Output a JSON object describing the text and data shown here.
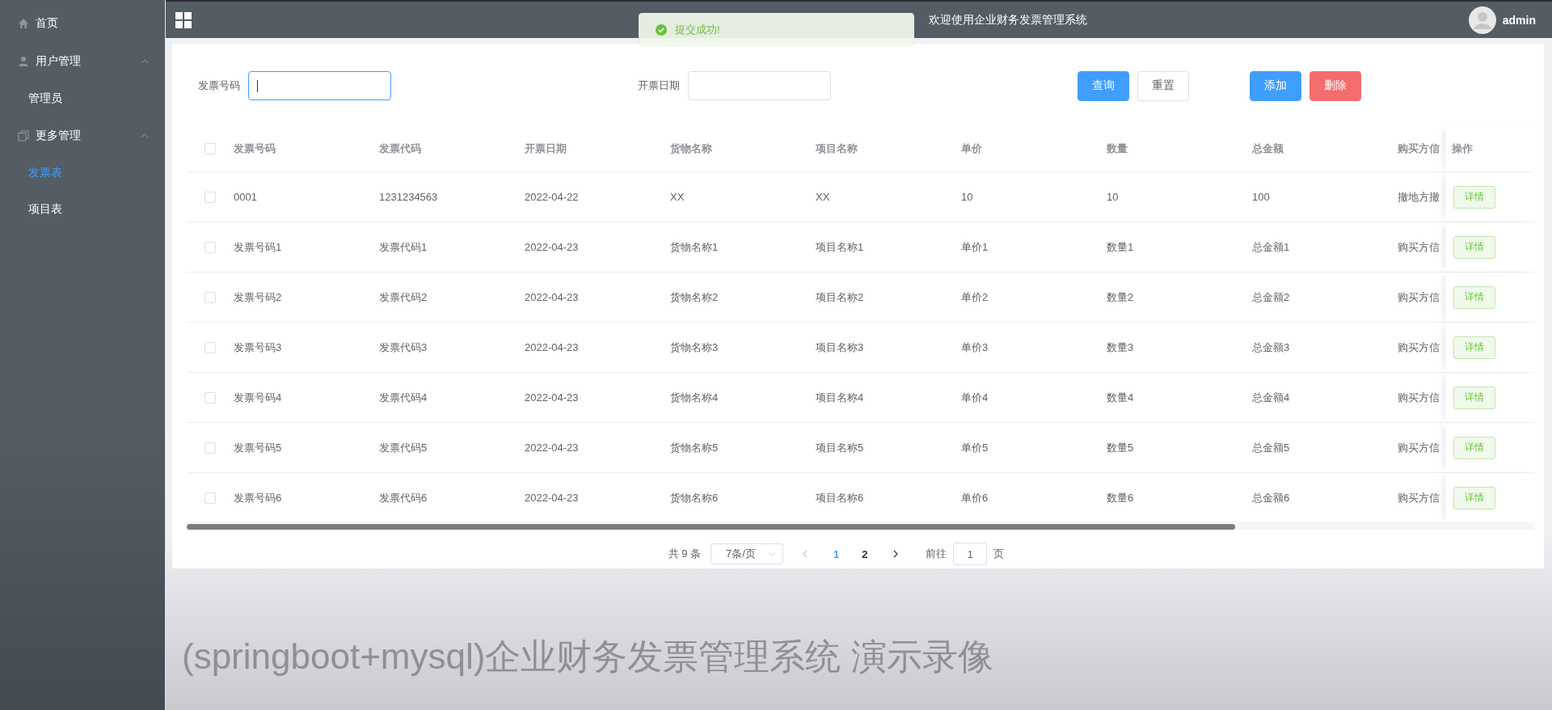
{
  "header": {
    "title": "欢迎使用企业财务发票管理系统",
    "user": "admin"
  },
  "toast": {
    "message": "提交成功!"
  },
  "sidebar": {
    "items": [
      {
        "label": "首页",
        "kind": "link",
        "selected": false
      },
      {
        "label": "用户管理",
        "kind": "group",
        "expanded": true,
        "children": [
          {
            "label": "管理员",
            "selected": false
          }
        ]
      },
      {
        "label": "更多管理",
        "kind": "group",
        "expanded": true,
        "children": [
          {
            "label": "发票表",
            "selected": true
          },
          {
            "label": "项目表",
            "selected": false
          }
        ]
      }
    ]
  },
  "filters": [
    {
      "label": "发票号码",
      "focused": true
    },
    {
      "label": "开票日期",
      "focused": false
    }
  ],
  "buttons": [
    {
      "label": "查询",
      "kind": "primary"
    },
    {
      "label": "重置",
      "kind": "default"
    },
    {
      "label": "添加",
      "kind": "primary"
    },
    {
      "label": "删除",
      "kind": "danger"
    }
  ],
  "table": {
    "all_checked": false,
    "columns": [
      "发票号码",
      "发票代码",
      "开票日期",
      "货物名称",
      "项目名称",
      "单价",
      "数量",
      "总金额",
      "购买方信"
    ],
    "action_column": "操作",
    "rows": [
      {
        "checked": false,
        "cells": [
          "0001",
          "1231234563",
          "2022-04-22",
          "XX",
          "XX",
          "10",
          "10",
          "100",
          "撤地方撤"
        ],
        "action": "详情"
      },
      {
        "checked": false,
        "cells": [
          "发票号码1",
          "发票代码1",
          "2022-04-23",
          "货物名称1",
          "项目名称1",
          "单价1",
          "数量1",
          "总金额1",
          "购买方信"
        ],
        "action": "详情"
      },
      {
        "checked": false,
        "cells": [
          "发票号码2",
          "发票代码2",
          "2022-04-23",
          "货物名称2",
          "项目名称2",
          "单价2",
          "数量2",
          "总金额2",
          "购买方信"
        ],
        "action": "详情"
      },
      {
        "checked": false,
        "cells": [
          "发票号码3",
          "发票代码3",
          "2022-04-23",
          "货物名称3",
          "项目名称3",
          "单价3",
          "数量3",
          "总金额3",
          "购买方信"
        ],
        "action": "详情"
      },
      {
        "checked": false,
        "cells": [
          "发票号码4",
          "发票代码4",
          "2022-04-23",
          "货物名称4",
          "项目名称4",
          "单价4",
          "数量4",
          "总金额4",
          "购买方信"
        ],
        "action": "详情"
      },
      {
        "checked": false,
        "cells": [
          "发票号码5",
          "发票代码5",
          "2022-04-23",
          "货物名称5",
          "项目名称5",
          "单价5",
          "数量5",
          "总金额5",
          "购买方信"
        ],
        "action": "详情"
      },
      {
        "checked": false,
        "cells": [
          "发票号码6",
          "发票代码6",
          "2022-04-23",
          "货物名称6",
          "项目名称6",
          "单价6",
          "数量6",
          "总金额6",
          "购买方信"
        ],
        "action": "详情"
      }
    ]
  },
  "pagination": {
    "total": "共 9 条",
    "page_size": "7条/页",
    "pages": [
      {
        "label": "1",
        "selected": true
      },
      {
        "label": "2",
        "selected": false
      }
    ],
    "goto_label": "前往",
    "goto_value": "1",
    "page_suffix": "页"
  },
  "caption": "(springboot+mysql)企业财务发票管理系统 演示录像"
}
